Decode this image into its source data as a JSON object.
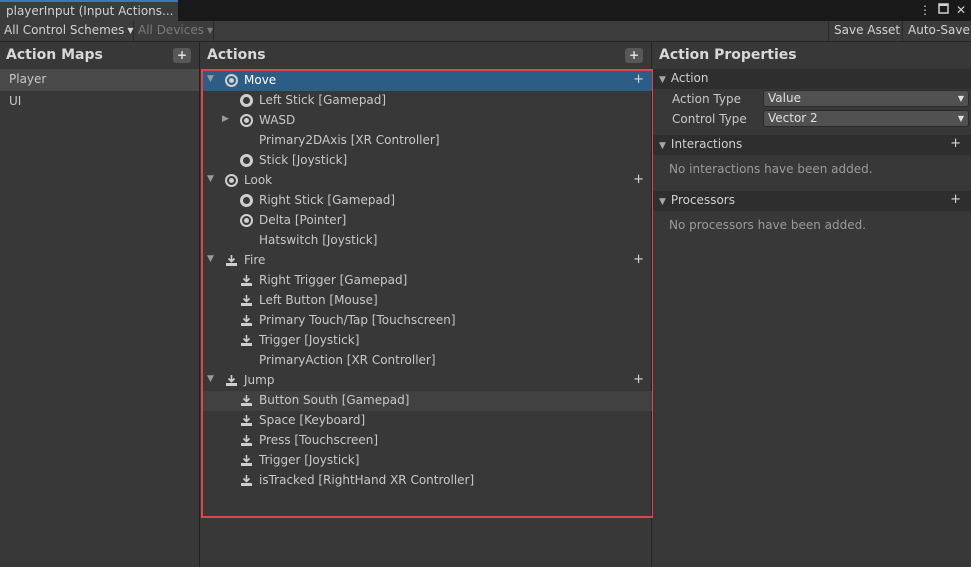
{
  "window": {
    "tab_title": "playerInput (Input Actions...",
    "menu_icon": "kebab-menu-icon",
    "maximize_icon": "maximize-icon",
    "close_icon": "close-icon"
  },
  "toolbar": {
    "control_schemes": "All Control Schemes",
    "devices": "All Devices",
    "save_asset": "Save Asset",
    "auto_save": "Auto-Save"
  },
  "action_maps": {
    "title": "Action Maps",
    "add_label": "+",
    "items": [
      {
        "label": "Player",
        "selected": true
      },
      {
        "label": "UI",
        "selected": false
      }
    ]
  },
  "actions": {
    "title": "Actions",
    "add_label": "+",
    "rows": [
      {
        "label": "Move",
        "kind": "action",
        "icon": "value-action-icon",
        "selected": true
      },
      {
        "label": "Left Stick [Gamepad]",
        "kind": "binding",
        "icon": "stick-icon"
      },
      {
        "label": "WASD",
        "kind": "composite",
        "icon": "value-action-icon"
      },
      {
        "label": "Primary2DAxis [XR Controller]",
        "kind": "binding",
        "icon": ""
      },
      {
        "label": "Stick [Joystick]",
        "kind": "binding",
        "icon": "stick-icon"
      },
      {
        "label": "Look",
        "kind": "action",
        "icon": "value-action-icon"
      },
      {
        "label": "Right Stick [Gamepad]",
        "kind": "binding",
        "icon": "stick-icon"
      },
      {
        "label": "Delta [Pointer]",
        "kind": "binding",
        "icon": "value-action-icon"
      },
      {
        "label": "Hatswitch [Joystick]",
        "kind": "binding",
        "icon": ""
      },
      {
        "label": "Fire",
        "kind": "action",
        "icon": "button-action-icon"
      },
      {
        "label": "Right Trigger [Gamepad]",
        "kind": "binding",
        "icon": "button-action-icon"
      },
      {
        "label": "Left Button [Mouse]",
        "kind": "binding",
        "icon": "button-action-icon"
      },
      {
        "label": "Primary Touch/Tap [Touchscreen]",
        "kind": "binding",
        "icon": "button-action-icon"
      },
      {
        "label": "Trigger [Joystick]",
        "kind": "binding",
        "icon": "button-action-icon"
      },
      {
        "label": "PrimaryAction [XR Controller]",
        "kind": "binding",
        "icon": ""
      },
      {
        "label": "Jump",
        "kind": "action",
        "icon": "button-action-icon"
      },
      {
        "label": "Button South [Gamepad]",
        "kind": "binding",
        "icon": "button-action-icon",
        "hover": true
      },
      {
        "label": "Space [Keyboard]",
        "kind": "binding",
        "icon": "button-action-icon"
      },
      {
        "label": "Press [Touchscreen]",
        "kind": "binding",
        "icon": "button-action-icon"
      },
      {
        "label": "Trigger [Joystick]",
        "kind": "binding",
        "icon": "button-action-icon"
      },
      {
        "label": "isTracked [RightHand XR Controller]",
        "kind": "binding",
        "icon": "button-action-icon"
      }
    ]
  },
  "properties": {
    "title": "Action Properties",
    "action_section": "Action",
    "action_type_label": "Action Type",
    "action_type_value": "Value",
    "control_type_label": "Control Type",
    "control_type_value": "Vector 2",
    "interactions_section": "Interactions",
    "interactions_empty": "No interactions have been added.",
    "processors_section": "Processors",
    "processors_empty": "No processors have been added.",
    "add_label": "+"
  },
  "colors": {
    "selection": "#2c5d87",
    "highlight_frame": "#e0454a",
    "tab_accent": "#3a79bb"
  }
}
